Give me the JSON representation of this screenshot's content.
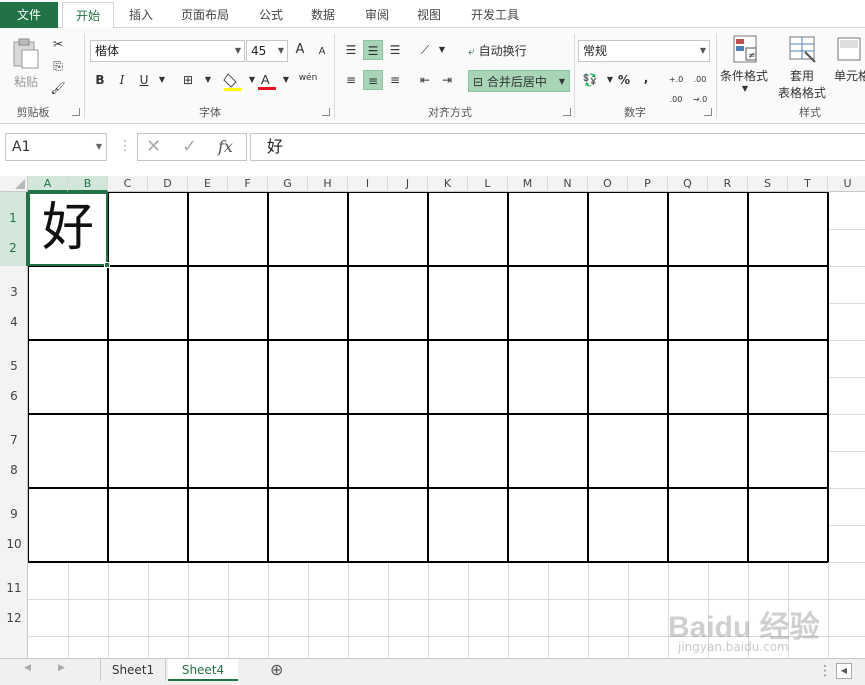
{
  "ribbon_tabs": [
    "文件",
    "开始",
    "插入",
    "页面布局",
    "公式",
    "数据",
    "审阅",
    "视图",
    "开发工具"
  ],
  "active_tab": "开始",
  "clipboard": {
    "paste_label": "粘贴",
    "group_label": "剪贴板"
  },
  "font": {
    "name": "楷体",
    "size": "45",
    "group_label": "字体",
    "bold": "B",
    "italic": "I",
    "underline": "U",
    "increase": "A",
    "decrease": "A",
    "phonetic": "wén",
    "fill_color": "#ffff00",
    "font_color": "#e81123"
  },
  "alignment": {
    "wrap_label": "自动换行",
    "merge_label": "合并后居中",
    "group_label": "对齐方式"
  },
  "number": {
    "format": "常规",
    "percent": "%",
    "comma": ",",
    "inc_dec": "+.0 .00",
    "dec_dec": ".00 →.0",
    "group_label": "数字"
  },
  "styles": {
    "conditional_label": "条件格式",
    "table_label_1": "套用",
    "table_label_2": "表格格式",
    "cell_label": "单元格",
    "group_label": "样式"
  },
  "name_box": "A1",
  "formula_value": "好",
  "fx_label": "fx",
  "columns": [
    "A",
    "B",
    "C",
    "D",
    "E",
    "F",
    "G",
    "H",
    "I",
    "J",
    "K",
    "L",
    "M",
    "N",
    "O",
    "P",
    "Q",
    "R",
    "S",
    "T",
    "U"
  ],
  "rows": [
    "1",
    "2",
    "3",
    "4",
    "5",
    "6",
    "7",
    "8",
    "9",
    "10",
    "11",
    "12"
  ],
  "cell_a1_value": "好",
  "sheets": [
    "Sheet1",
    "Sheet4"
  ],
  "active_sheet": "Sheet4",
  "add_sheet": "⊕",
  "watermark": "Baidu 经验",
  "watermark_url": "jingyan.baidu.com",
  "colors": {
    "accent": "#217346",
    "highlight": "#a7d5b6"
  }
}
